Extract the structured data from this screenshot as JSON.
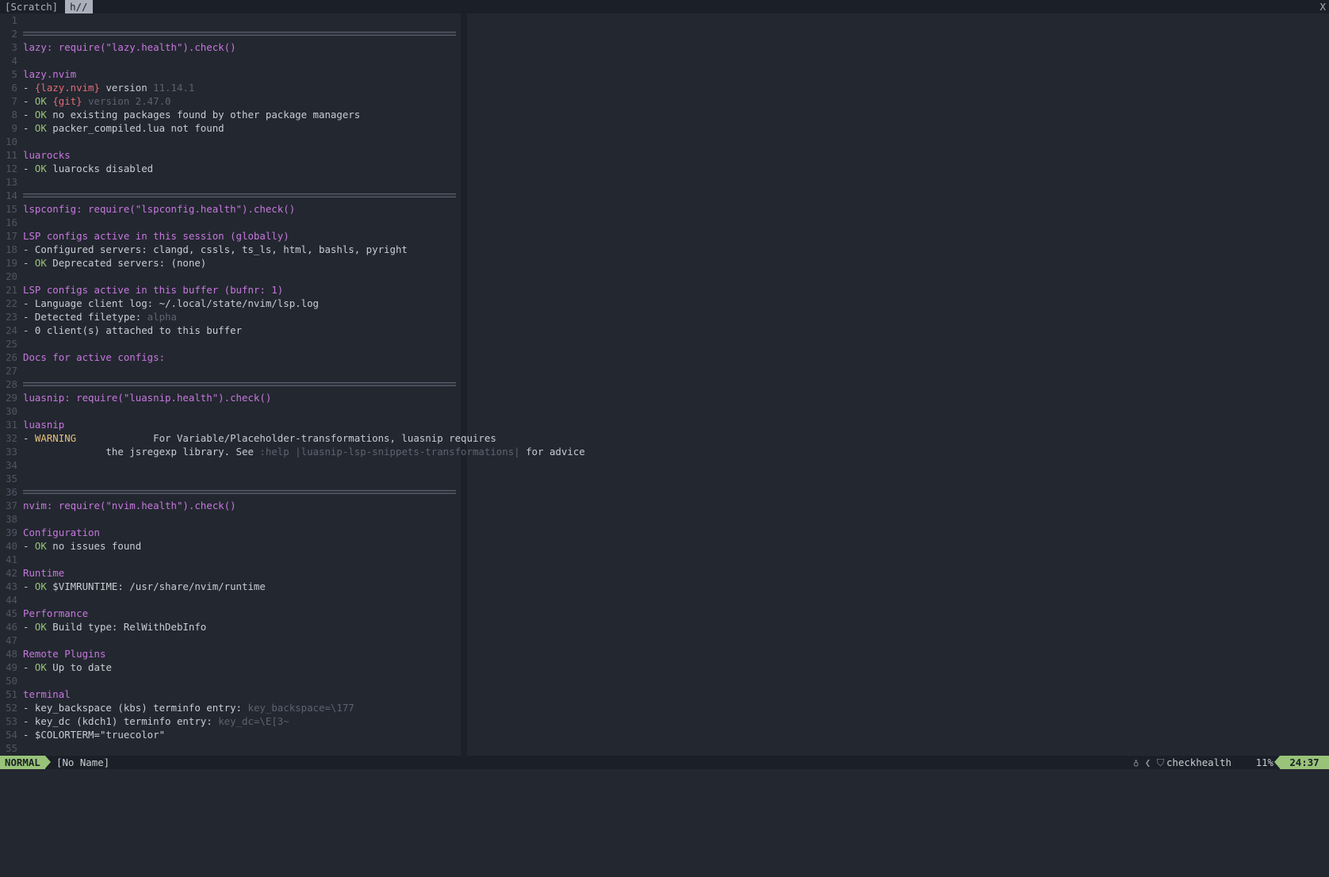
{
  "tabline": {
    "tabs": [
      {
        "label": "[Scratch]",
        "active": false
      },
      {
        "label": "h//",
        "active": true
      }
    ],
    "close_label": "X"
  },
  "buffer": {
    "lines": [
      {
        "n": "1",
        "rule": false,
        "segs": []
      },
      {
        "n": "2",
        "rule": true,
        "segs": []
      },
      {
        "n": "3",
        "rule": false,
        "segs": [
          {
            "t": "lazy: require(\"lazy.health\").check()",
            "c": "head"
          }
        ]
      },
      {
        "n": "4",
        "rule": false,
        "segs": []
      },
      {
        "n": "5",
        "rule": false,
        "segs": [
          {
            "t": "lazy.nvim",
            "c": "head"
          }
        ]
      },
      {
        "n": "6",
        "rule": false,
        "segs": [
          {
            "t": "- ",
            "c": "text"
          },
          {
            "t": "{lazy.nvim}",
            "c": "red"
          },
          {
            "t": " version ",
            "c": "text"
          },
          {
            "t": "11.14.1",
            "c": "dim"
          }
        ]
      },
      {
        "n": "7",
        "rule": false,
        "segs": [
          {
            "t": "- ",
            "c": "text"
          },
          {
            "t": "OK",
            "c": "ok"
          },
          {
            "t": " ",
            "c": "text"
          },
          {
            "t": "{git}",
            "c": "red"
          },
          {
            "t": " version 2.47.0",
            "c": "dim"
          }
        ]
      },
      {
        "n": "8",
        "rule": false,
        "segs": [
          {
            "t": "- ",
            "c": "text"
          },
          {
            "t": "OK",
            "c": "ok"
          },
          {
            "t": " no existing packages found by other package managers",
            "c": "text"
          }
        ]
      },
      {
        "n": "9",
        "rule": false,
        "segs": [
          {
            "t": "- ",
            "c": "text"
          },
          {
            "t": "OK",
            "c": "ok"
          },
          {
            "t": " packer_compiled.lua not found",
            "c": "text"
          }
        ]
      },
      {
        "n": "10",
        "rule": false,
        "segs": []
      },
      {
        "n": "11",
        "rule": false,
        "segs": [
          {
            "t": "luarocks",
            "c": "head"
          }
        ]
      },
      {
        "n": "12",
        "rule": false,
        "segs": [
          {
            "t": "- ",
            "c": "text"
          },
          {
            "t": "OK",
            "c": "ok"
          },
          {
            "t": " luarocks disabled",
            "c": "text"
          }
        ]
      },
      {
        "n": "13",
        "rule": false,
        "segs": []
      },
      {
        "n": "14",
        "rule": true,
        "segs": []
      },
      {
        "n": "15",
        "rule": false,
        "segs": [
          {
            "t": "lspconfig: require(\"lspconfig.health\").check()",
            "c": "head"
          }
        ]
      },
      {
        "n": "16",
        "rule": false,
        "segs": []
      },
      {
        "n": "17",
        "rule": false,
        "segs": [
          {
            "t": "LSP configs active in this session (globally)",
            "c": "head"
          }
        ]
      },
      {
        "n": "18",
        "rule": false,
        "segs": [
          {
            "t": "- Configured servers: clangd, cssls, ts_ls, html, bashls, pyright",
            "c": "text"
          }
        ]
      },
      {
        "n": "19",
        "rule": false,
        "segs": [
          {
            "t": "- ",
            "c": "text"
          },
          {
            "t": "OK",
            "c": "ok"
          },
          {
            "t": " Deprecated servers: (none)",
            "c": "text"
          }
        ]
      },
      {
        "n": "20",
        "rule": false,
        "segs": []
      },
      {
        "n": "21",
        "rule": false,
        "segs": [
          {
            "t": "LSP configs active in this buffer (bufnr: 1)",
            "c": "head"
          }
        ]
      },
      {
        "n": "22",
        "rule": false,
        "segs": [
          {
            "t": "- Language client log: ~/.local/state/nvim/lsp.log",
            "c": "text"
          }
        ]
      },
      {
        "n": "23",
        "rule": false,
        "segs": [
          {
            "t": "- Detected filetype: ",
            "c": "text"
          },
          {
            "t": "alpha",
            "c": "dim"
          }
        ]
      },
      {
        "n": "24",
        "rule": false,
        "segs": [
          {
            "t": "- 0 client(s) attached to this buffe",
            "c": "text"
          },
          {
            "t": "r",
            "c": "cursor"
          }
        ]
      },
      {
        "n": "25",
        "rule": false,
        "segs": []
      },
      {
        "n": "26",
        "rule": false,
        "segs": [
          {
            "t": "Docs for active configs:",
            "c": "head"
          }
        ]
      },
      {
        "n": "27",
        "rule": false,
        "segs": []
      },
      {
        "n": "28",
        "rule": true,
        "segs": []
      },
      {
        "n": "29",
        "rule": false,
        "segs": [
          {
            "t": "luasnip: require(\"luasnip.health\").check()",
            "c": "head"
          }
        ]
      },
      {
        "n": "30",
        "rule": false,
        "segs": []
      },
      {
        "n": "31",
        "rule": false,
        "segs": [
          {
            "t": "luasnip",
            "c": "head"
          }
        ]
      },
      {
        "n": "32",
        "rule": false,
        "segs": [
          {
            "t": "- ",
            "c": "text"
          },
          {
            "t": "WARNING",
            "c": "warn"
          },
          {
            "t": "             For Variable/Placeholder-transformations, luasnip requires",
            "c": "text"
          }
        ]
      },
      {
        "n": "33",
        "rule": false,
        "segs": [
          {
            "t": "              the jsregexp library. See ",
            "c": "text"
          },
          {
            "t": ":help |luasnip-lsp-snippets-transformations|",
            "c": "dim"
          },
          {
            "t": " for advice",
            "c": "text"
          }
        ]
      },
      {
        "n": "34",
        "rule": false,
        "segs": []
      },
      {
        "n": "35",
        "rule": false,
        "segs": []
      },
      {
        "n": "36",
        "rule": true,
        "segs": []
      },
      {
        "n": "37",
        "rule": false,
        "segs": [
          {
            "t": "nvim: require(\"nvim.health\").check()",
            "c": "head"
          }
        ]
      },
      {
        "n": "38",
        "rule": false,
        "segs": []
      },
      {
        "n": "39",
        "rule": false,
        "segs": [
          {
            "t": "Configuration",
            "c": "head"
          }
        ]
      },
      {
        "n": "40",
        "rule": false,
        "segs": [
          {
            "t": "- ",
            "c": "text"
          },
          {
            "t": "OK",
            "c": "ok"
          },
          {
            "t": " no issues found",
            "c": "text"
          }
        ]
      },
      {
        "n": "41",
        "rule": false,
        "segs": []
      },
      {
        "n": "42",
        "rule": false,
        "segs": [
          {
            "t": "Runtime",
            "c": "head"
          }
        ]
      },
      {
        "n": "43",
        "rule": false,
        "segs": [
          {
            "t": "- ",
            "c": "text"
          },
          {
            "t": "OK",
            "c": "ok"
          },
          {
            "t": " $VIMRUNTIME: /usr/share/nvim/runtime",
            "c": "text"
          }
        ]
      },
      {
        "n": "44",
        "rule": false,
        "segs": []
      },
      {
        "n": "45",
        "rule": false,
        "segs": [
          {
            "t": "Performance",
            "c": "head"
          }
        ]
      },
      {
        "n": "46",
        "rule": false,
        "segs": [
          {
            "t": "- ",
            "c": "text"
          },
          {
            "t": "OK",
            "c": "ok"
          },
          {
            "t": " Build type: RelWithDebInfo",
            "c": "text"
          }
        ]
      },
      {
        "n": "47",
        "rule": false,
        "segs": []
      },
      {
        "n": "48",
        "rule": false,
        "segs": [
          {
            "t": "Remote Plugins",
            "c": "head"
          }
        ]
      },
      {
        "n": "49",
        "rule": false,
        "segs": [
          {
            "t": "- ",
            "c": "text"
          },
          {
            "t": "OK",
            "c": "ok"
          },
          {
            "t": " Up to date",
            "c": "text"
          }
        ]
      },
      {
        "n": "50",
        "rule": false,
        "segs": []
      },
      {
        "n": "51",
        "rule": false,
        "segs": [
          {
            "t": "terminal",
            "c": "head"
          }
        ]
      },
      {
        "n": "52",
        "rule": false,
        "segs": [
          {
            "t": "- key_backspace (kbs) terminfo entry: ",
            "c": "text"
          },
          {
            "t": "key_backspace=\\177",
            "c": "dim"
          }
        ]
      },
      {
        "n": "53",
        "rule": false,
        "segs": [
          {
            "t": "- key_dc (kdch1) terminfo entry: ",
            "c": "text"
          },
          {
            "t": "key_dc=\\E[3~",
            "c": "dim"
          }
        ]
      },
      {
        "n": "54",
        "rule": false,
        "segs": [
          {
            "t": "- $COLORTERM=\"truecolor\"",
            "c": "text"
          }
        ]
      },
      {
        "n": "55",
        "rule": false,
        "segs": []
      }
    ]
  },
  "statusline": {
    "mode": "NORMAL",
    "filename": "[No Name]",
    "icons": "♁ ❮ ⛉",
    "filetype": "checkhealth",
    "percent": "11%",
    "position": "24:37"
  },
  "colors": {
    "background": "#232730",
    "heading": "#c678dd",
    "ok": "#98c379",
    "warning": "#e5c07b",
    "accent_red": "#e06c75",
    "mode_bg": "#98c379"
  }
}
